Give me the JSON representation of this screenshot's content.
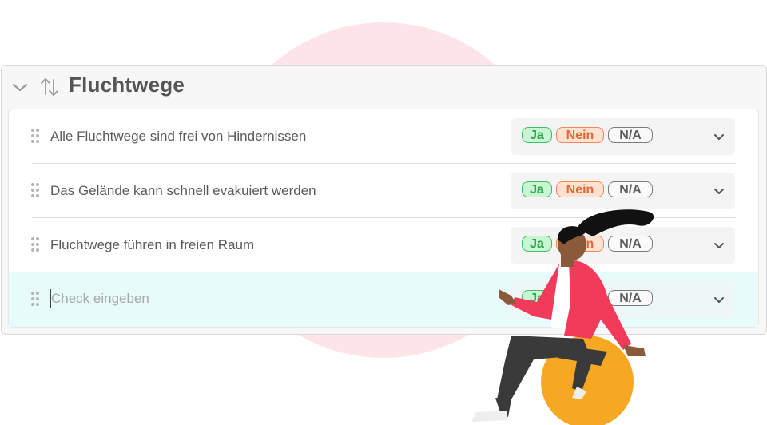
{
  "section": {
    "title": "Fluchtwege",
    "icons": {
      "collapse": "chevron-down-icon",
      "sort": "sort-arrows-icon"
    }
  },
  "checks": [
    {
      "text": "Alle Fluchtwege sind frei von Hindernissen"
    },
    {
      "text": "Das Gelände kann schnell evakuiert werden"
    },
    {
      "text": "Fluchtwege führen in freien Raum"
    }
  ],
  "new_check": {
    "placeholder": "Check eingeben",
    "value": ""
  },
  "answers": {
    "ja": "Ja",
    "nein": "Nein",
    "na": "N/A"
  },
  "colors": {
    "ja": "#3fbf63",
    "nein": "#f0865a",
    "na": "#7a7a7a",
    "active_row": "#e8fbfb",
    "background_circle": "#fde4e8",
    "jacket": "#f23a5a",
    "ball": "#f7a823"
  }
}
